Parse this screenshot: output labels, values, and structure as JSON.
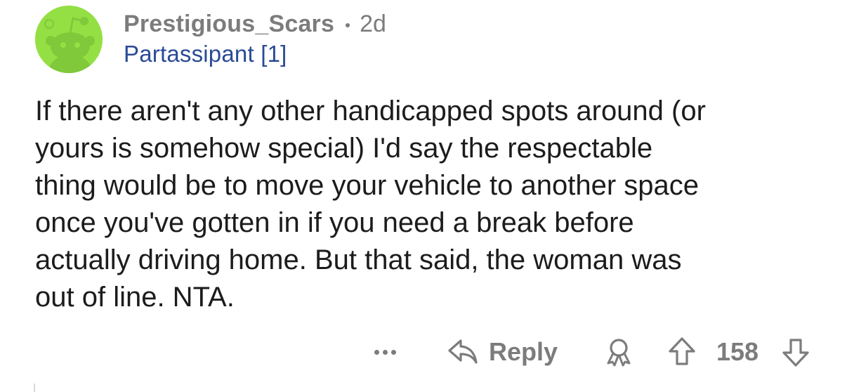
{
  "comment": {
    "avatar_icon": "reddit-snoo-avatar-icon",
    "avatar_color": "#94e044",
    "username": "Prestigious_Scars",
    "age": "2d",
    "flair": "Partassipant [1]",
    "flair_color": "#2a4a96",
    "body_lines": [
      "If there aren't any other handicapped spots around (or",
      "yours is somehow special) I'd say the respectable",
      "thing would be to move your vehicle to another space",
      "once you've gotten in if you need a break before",
      "actually driving home. But that said, the woman was",
      "out of line. NTA."
    ]
  },
  "actions": {
    "more_icon": "more-options-icon",
    "reply_icon": "reply-arrow-icon",
    "reply_label": "Reply",
    "award_icon": "award-icon",
    "upvote_icon": "upvote-arrow-icon",
    "score": "158",
    "downvote_icon": "downvote-arrow-icon"
  }
}
